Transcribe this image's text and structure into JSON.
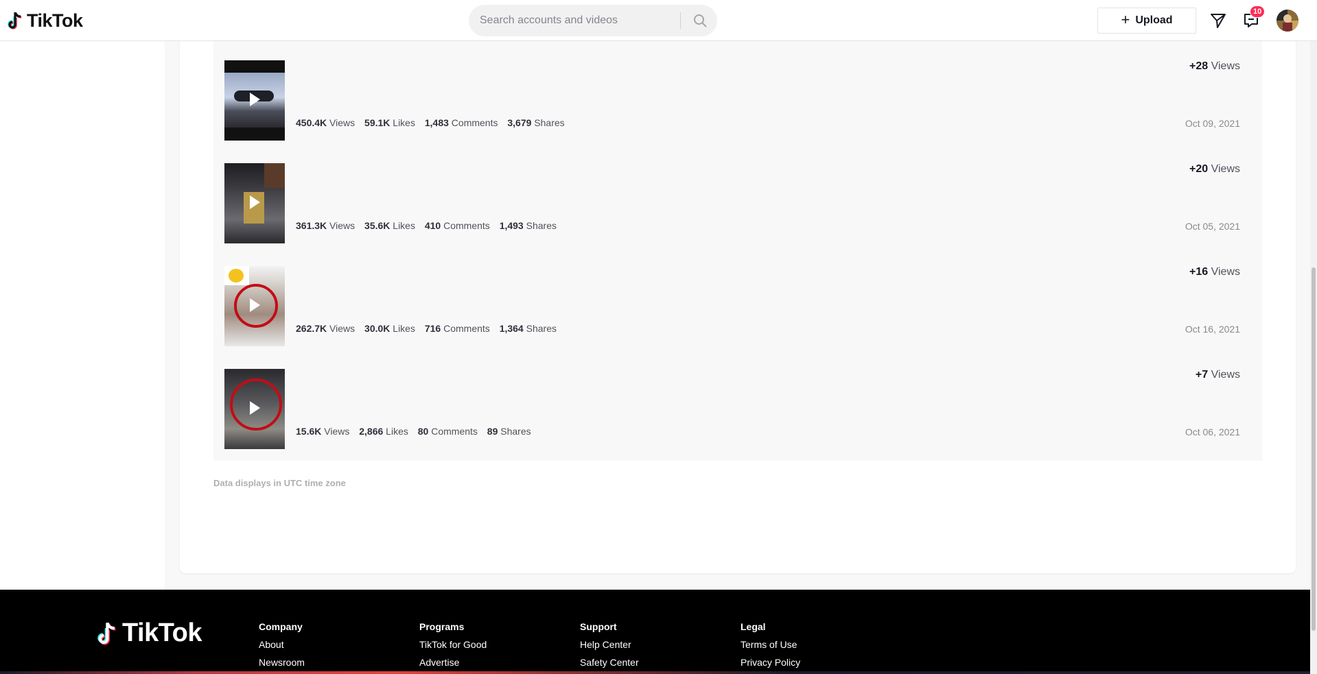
{
  "header": {
    "logo_text": "TikTok",
    "search_placeholder": "Search accounts and videos",
    "upload_label": "Upload",
    "inbox_badge": "10"
  },
  "videos": [
    {
      "views": "450.4K",
      "likes": "59.1K",
      "comments": "1,483",
      "shares": "3,679",
      "delta": "+28",
      "date": "Oct 09, 2021"
    },
    {
      "views": "361.3K",
      "likes": "35.6K",
      "comments": "410",
      "shares": "1,493",
      "delta": "+20",
      "date": "Oct 05, 2021"
    },
    {
      "views": "262.7K",
      "likes": "30.0K",
      "comments": "716",
      "shares": "1,364",
      "delta": "+16",
      "date": "Oct 16, 2021"
    },
    {
      "views": "15.6K",
      "likes": "2,866",
      "comments": "80",
      "shares": "89",
      "delta": "+7",
      "date": "Oct 06, 2021"
    }
  ],
  "labels": {
    "views": "Views",
    "likes": "Likes",
    "comments": "Comments",
    "shares": "Shares"
  },
  "timezone_note": "Data displays in UTC time zone",
  "footer": {
    "logo_text": "TikTok",
    "columns": [
      {
        "title": "Company",
        "links": [
          "About",
          "Newsroom"
        ]
      },
      {
        "title": "Programs",
        "links": [
          "TikTok for Good",
          "Advertise"
        ]
      },
      {
        "title": "Support",
        "links": [
          "Help Center",
          "Safety Center"
        ]
      },
      {
        "title": "Legal",
        "links": [
          "Terms of Use",
          "Privacy Policy"
        ]
      }
    ]
  },
  "colors": {
    "accent": "#fe2c55",
    "cyan": "#25f4ee"
  }
}
